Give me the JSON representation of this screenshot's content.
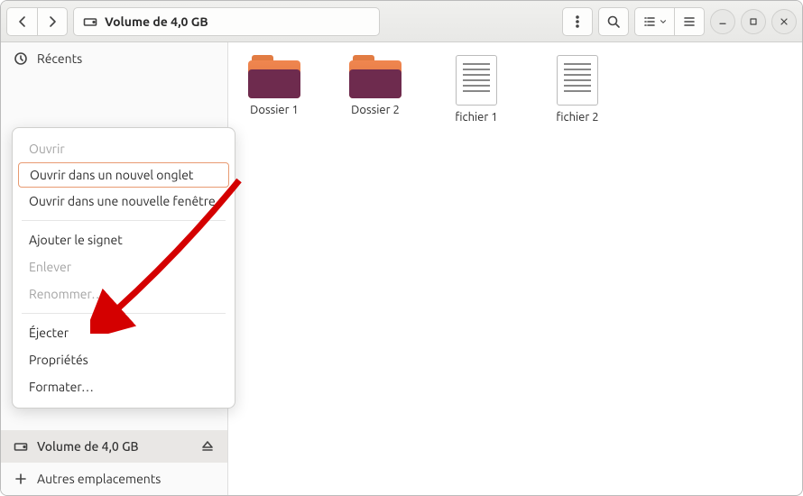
{
  "header": {
    "path_label": "Volume de 4,0 GB"
  },
  "sidebar": {
    "recent": "Récents",
    "volume": "Volume de 4,0 GB",
    "other": "Autres emplacements"
  },
  "files": [
    {
      "name": "Dossier 1",
      "type": "folder"
    },
    {
      "name": "Dossier 2",
      "type": "folder"
    },
    {
      "name": "fichier 1",
      "type": "file"
    },
    {
      "name": "fichier 2",
      "type": "file"
    }
  ],
  "menu": {
    "open": "Ouvrir",
    "open_tab": "Ouvrir dans un nouvel onglet",
    "open_window": "Ouvrir dans une nouvelle fenêtre",
    "bookmark": "Ajouter le signet",
    "remove": "Enlever",
    "rename": "Renommer…",
    "eject": "Éjecter",
    "properties": "Propriétés",
    "format": "Formater…"
  }
}
